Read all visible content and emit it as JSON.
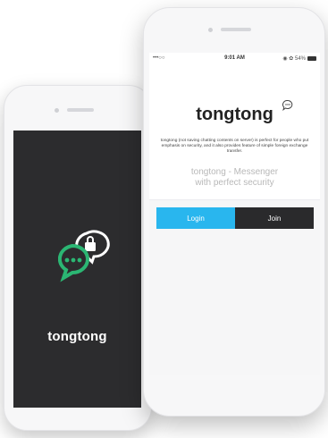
{
  "back_phone": {
    "brand": "tongtong"
  },
  "front_phone": {
    "status": {
      "signal": "•••○○",
      "time": "9:01 AM",
      "battery": "◉ ✿ 54%"
    },
    "brand": "tongtong",
    "description": "tongtong (not saving chatting contents on server) is perfect for people who put emphasis on security, and it also provides feature of simple foreign exchange transfer.",
    "tagline_line1": "tongtong - Messenger",
    "tagline_line2": "with perfect security",
    "login_label": "Login",
    "join_label": "Join"
  },
  "colors": {
    "accent": "#29b6ee",
    "logo_green": "#2bb673",
    "dark": "#2a2a2c"
  }
}
